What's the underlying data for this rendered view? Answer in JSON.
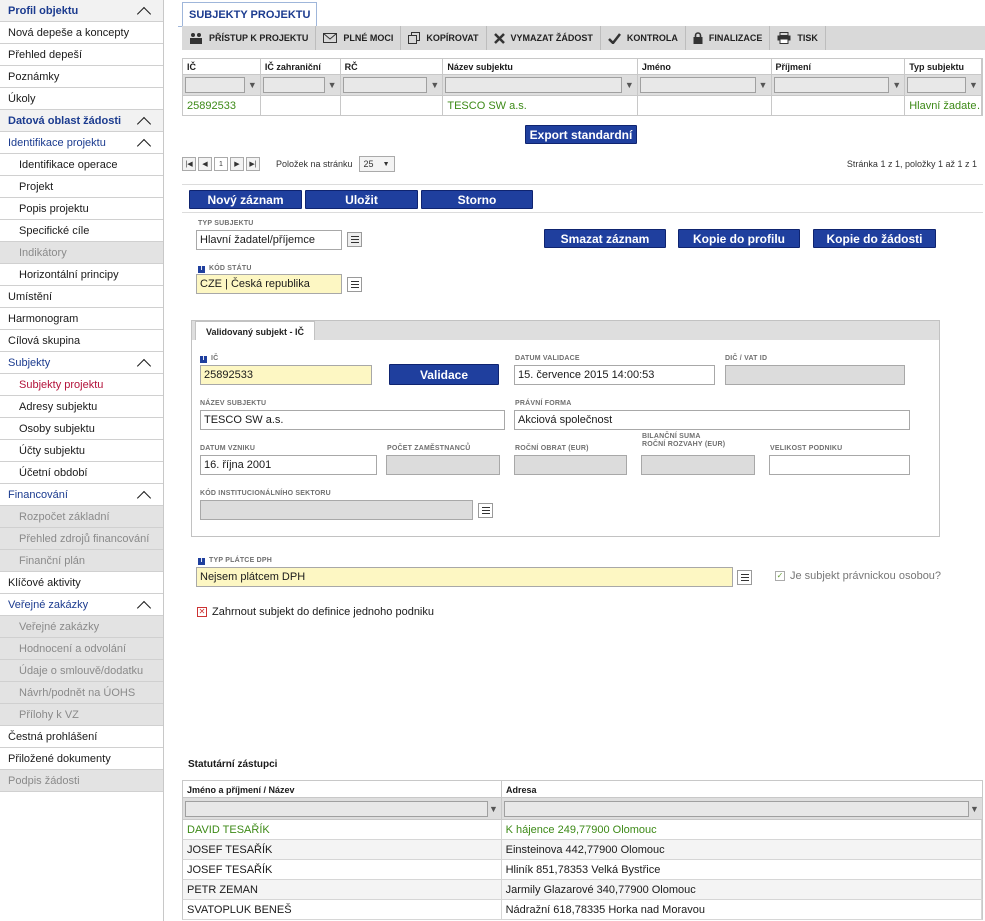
{
  "sidebar": {
    "items": [
      {
        "label": "Profil objektu",
        "type": "hdr",
        "chev": true
      },
      {
        "label": "Nová depeše a koncepty",
        "type": "norm"
      },
      {
        "label": "Přehled depeší",
        "type": "norm"
      },
      {
        "label": "Poznámky",
        "type": "norm"
      },
      {
        "label": "Úkoly",
        "type": "norm"
      },
      {
        "label": "Datová oblast žádosti",
        "type": "hdr",
        "chev": true
      },
      {
        "label": "Identifikace projektu",
        "type": "sec",
        "chev": true
      },
      {
        "label": "Identifikace operace",
        "type": "sub"
      },
      {
        "label": "Projekt",
        "type": "sub"
      },
      {
        "label": "Popis projektu",
        "type": "sub"
      },
      {
        "label": "Specifické cíle",
        "type": "sub"
      },
      {
        "label": "Indikátory",
        "type": "subdis"
      },
      {
        "label": "Horizontální principy",
        "type": "sub"
      },
      {
        "label": "Umístění",
        "type": "norm"
      },
      {
        "label": "Harmonogram",
        "type": "norm"
      },
      {
        "label": "Cílová skupina",
        "type": "norm"
      },
      {
        "label": "Subjekty",
        "type": "sec",
        "chev": true
      },
      {
        "label": "Subjekty projektu",
        "type": "subact"
      },
      {
        "label": "Adresy subjektu",
        "type": "sub"
      },
      {
        "label": "Osoby subjektu",
        "type": "sub"
      },
      {
        "label": "Účty subjektu",
        "type": "sub"
      },
      {
        "label": "Účetní období",
        "type": "sub"
      },
      {
        "label": "Financování",
        "type": "sec",
        "chev": true
      },
      {
        "label": "Rozpočet základní",
        "type": "subdis"
      },
      {
        "label": "Přehled zdrojů financování",
        "type": "subdis"
      },
      {
        "label": "Finanční plán",
        "type": "subdis"
      },
      {
        "label": "Klíčové aktivity",
        "type": "norm"
      },
      {
        "label": "Veřejné zakázky",
        "type": "sec",
        "chev": true
      },
      {
        "label": "Veřejné zakázky",
        "type": "subdis"
      },
      {
        "label": "Hodnocení a odvolání",
        "type": "subdis"
      },
      {
        "label": "Údaje o smlouvě/dodatku",
        "type": "subdis"
      },
      {
        "label": "Návrh/podnět na ÚOHS",
        "type": "subdis"
      },
      {
        "label": "Přílohy k VZ",
        "type": "subdis"
      },
      {
        "label": "Čestná prohlášení",
        "type": "norm"
      },
      {
        "label": "Přiložené dokumenty",
        "type": "norm"
      },
      {
        "label": "Podpis žádosti",
        "type": "dis"
      }
    ]
  },
  "tab": {
    "title": "SUBJEKTY PROJEKTU"
  },
  "toolbar": {
    "items": [
      {
        "label": "PŘÍSTUP K PROJEKTU",
        "icon": "people-icon"
      },
      {
        "label": "PLNÉ MOCI",
        "icon": "envelope-icon"
      },
      {
        "label": "KOPÍROVAT",
        "icon": "copy-icon"
      },
      {
        "label": "VYMAZAT ŽÁDOST",
        "icon": "close-icon"
      },
      {
        "label": "KONTROLA",
        "icon": "check-icon"
      },
      {
        "label": "FINALIZACE",
        "icon": "lock-icon"
      },
      {
        "label": "TISK",
        "icon": "print-icon"
      }
    ]
  },
  "grid": {
    "columns": [
      "IČ",
      "IČ zahraniční",
      "RČ",
      "Název subjektu",
      "Jméno",
      "Příjmení",
      "Typ subjektu"
    ],
    "rows": [
      [
        "25892533",
        "",
        "",
        "TESCO SW a.s.",
        "",
        "",
        "Hlavní žadate…"
      ]
    ]
  },
  "export_label": "Export standardní",
  "pager": {
    "page": "1",
    "per_page_label": "Položek na stránku",
    "per_page": "25",
    "summary": "Stránka 1 z 1, položky 1 až 1 z 1"
  },
  "buttons": {
    "new": "Nový záznam",
    "save": "Uložit",
    "cancel": "Storno",
    "delete": "Smazat záznam",
    "copy_profile": "Kopie do profilu",
    "copy_request": "Kopie do žádosti",
    "validate": "Validace"
  },
  "form": {
    "typ_subjektu_label": "TYP SUBJEKTU",
    "typ_subjektu": "Hlavní žadatel/příjemce",
    "kod_statu_label": "KÓD STÁTU",
    "kod_statu": "CZE | Česká republika",
    "val_tab": "Validovaný subjekt - IČ",
    "ic_label": "IČ",
    "ic": "25892533",
    "datum_validace_label": "DATUM VALIDACE",
    "datum_validace": "15. července 2015 14:00:53",
    "dic_label": "DIČ / VAT ID",
    "dic": "",
    "nazev_label": "NÁZEV SUBJEKTU",
    "nazev": "TESCO SW a.s.",
    "pravni_forma_label": "PRÁVNÍ FORMA",
    "pravni_forma": "Akciová společnost",
    "datum_vzniku_label": "DATUM VZNIKU",
    "datum_vzniku": "16. října 2001",
    "pocet_label": "POČET ZAMĚSTNANCŮ",
    "obrat_label": "ROČNÍ OBRAT (EUR)",
    "bilancni_label1": "BILANČNÍ SUMA",
    "bilancni_label2": "ROČNÍ ROZVAHY (EUR)",
    "velikost_label": "VELIKOST PODNIKU",
    "sektor_label": "KÓD INSTITUCIONÁLNÍHO SEKTORU",
    "platce_label": "TYP PLÁTCE DPH",
    "platce": "Nejsem plátcem DPH",
    "pravnicka_label": "Je subjekt právnickou osobou?",
    "zahrnout_label": "Zahrnout subjekt do definice jednoho podniku"
  },
  "statutory": {
    "title": "Statutární zástupci",
    "columns": [
      "Jméno a příjmení / Název",
      "Adresa"
    ],
    "rows": [
      [
        "DAVID TESAŘÍK",
        "K hájence 249,77900 Olomouc"
      ],
      [
        "JOSEF TESAŘÍK",
        "Einsteinova 442,77900 Olomouc"
      ],
      [
        "JOSEF TESAŘÍK",
        "Hliník 851,78353 Velká Bystřice"
      ],
      [
        "PETR ZEMAN",
        "Jarmily Glazarové 340,77900 Olomouc"
      ],
      [
        "SVATOPLUK BENEŠ",
        "Nádražní 618,78335 Horka nad Moravou"
      ]
    ]
  }
}
